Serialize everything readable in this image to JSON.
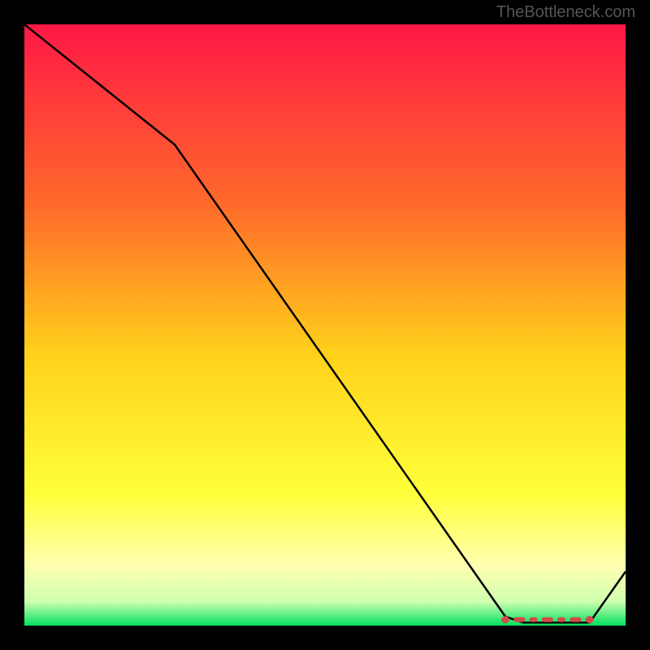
{
  "watermark": "TheBottleneck.com",
  "chart_data": {
    "type": "line",
    "title": "",
    "xlabel": "",
    "ylabel": "",
    "xlim": [
      0,
      100
    ],
    "ylim": [
      0,
      100
    ],
    "x": [
      0,
      25,
      80,
      83,
      94,
      100
    ],
    "values": [
      100,
      80,
      1.5,
      0.5,
      0.5,
      9
    ],
    "optimal_band": {
      "x_start": 80,
      "x_end": 94,
      "y": 1.0
    },
    "background": {
      "type": "vertical-gradient",
      "stops": [
        {
          "pos": 0.0,
          "color": "#ff1846"
        },
        {
          "pos": 0.3,
          "color": "#ff6a2a"
        },
        {
          "pos": 0.55,
          "color": "#ffd21a"
        },
        {
          "pos": 0.78,
          "color": "#ffff3a"
        },
        {
          "pos": 0.9,
          "color": "#ffffb0"
        },
        {
          "pos": 0.96,
          "color": "#d0ffb0"
        },
        {
          "pos": 1.0,
          "color": "#00e060"
        }
      ]
    }
  }
}
